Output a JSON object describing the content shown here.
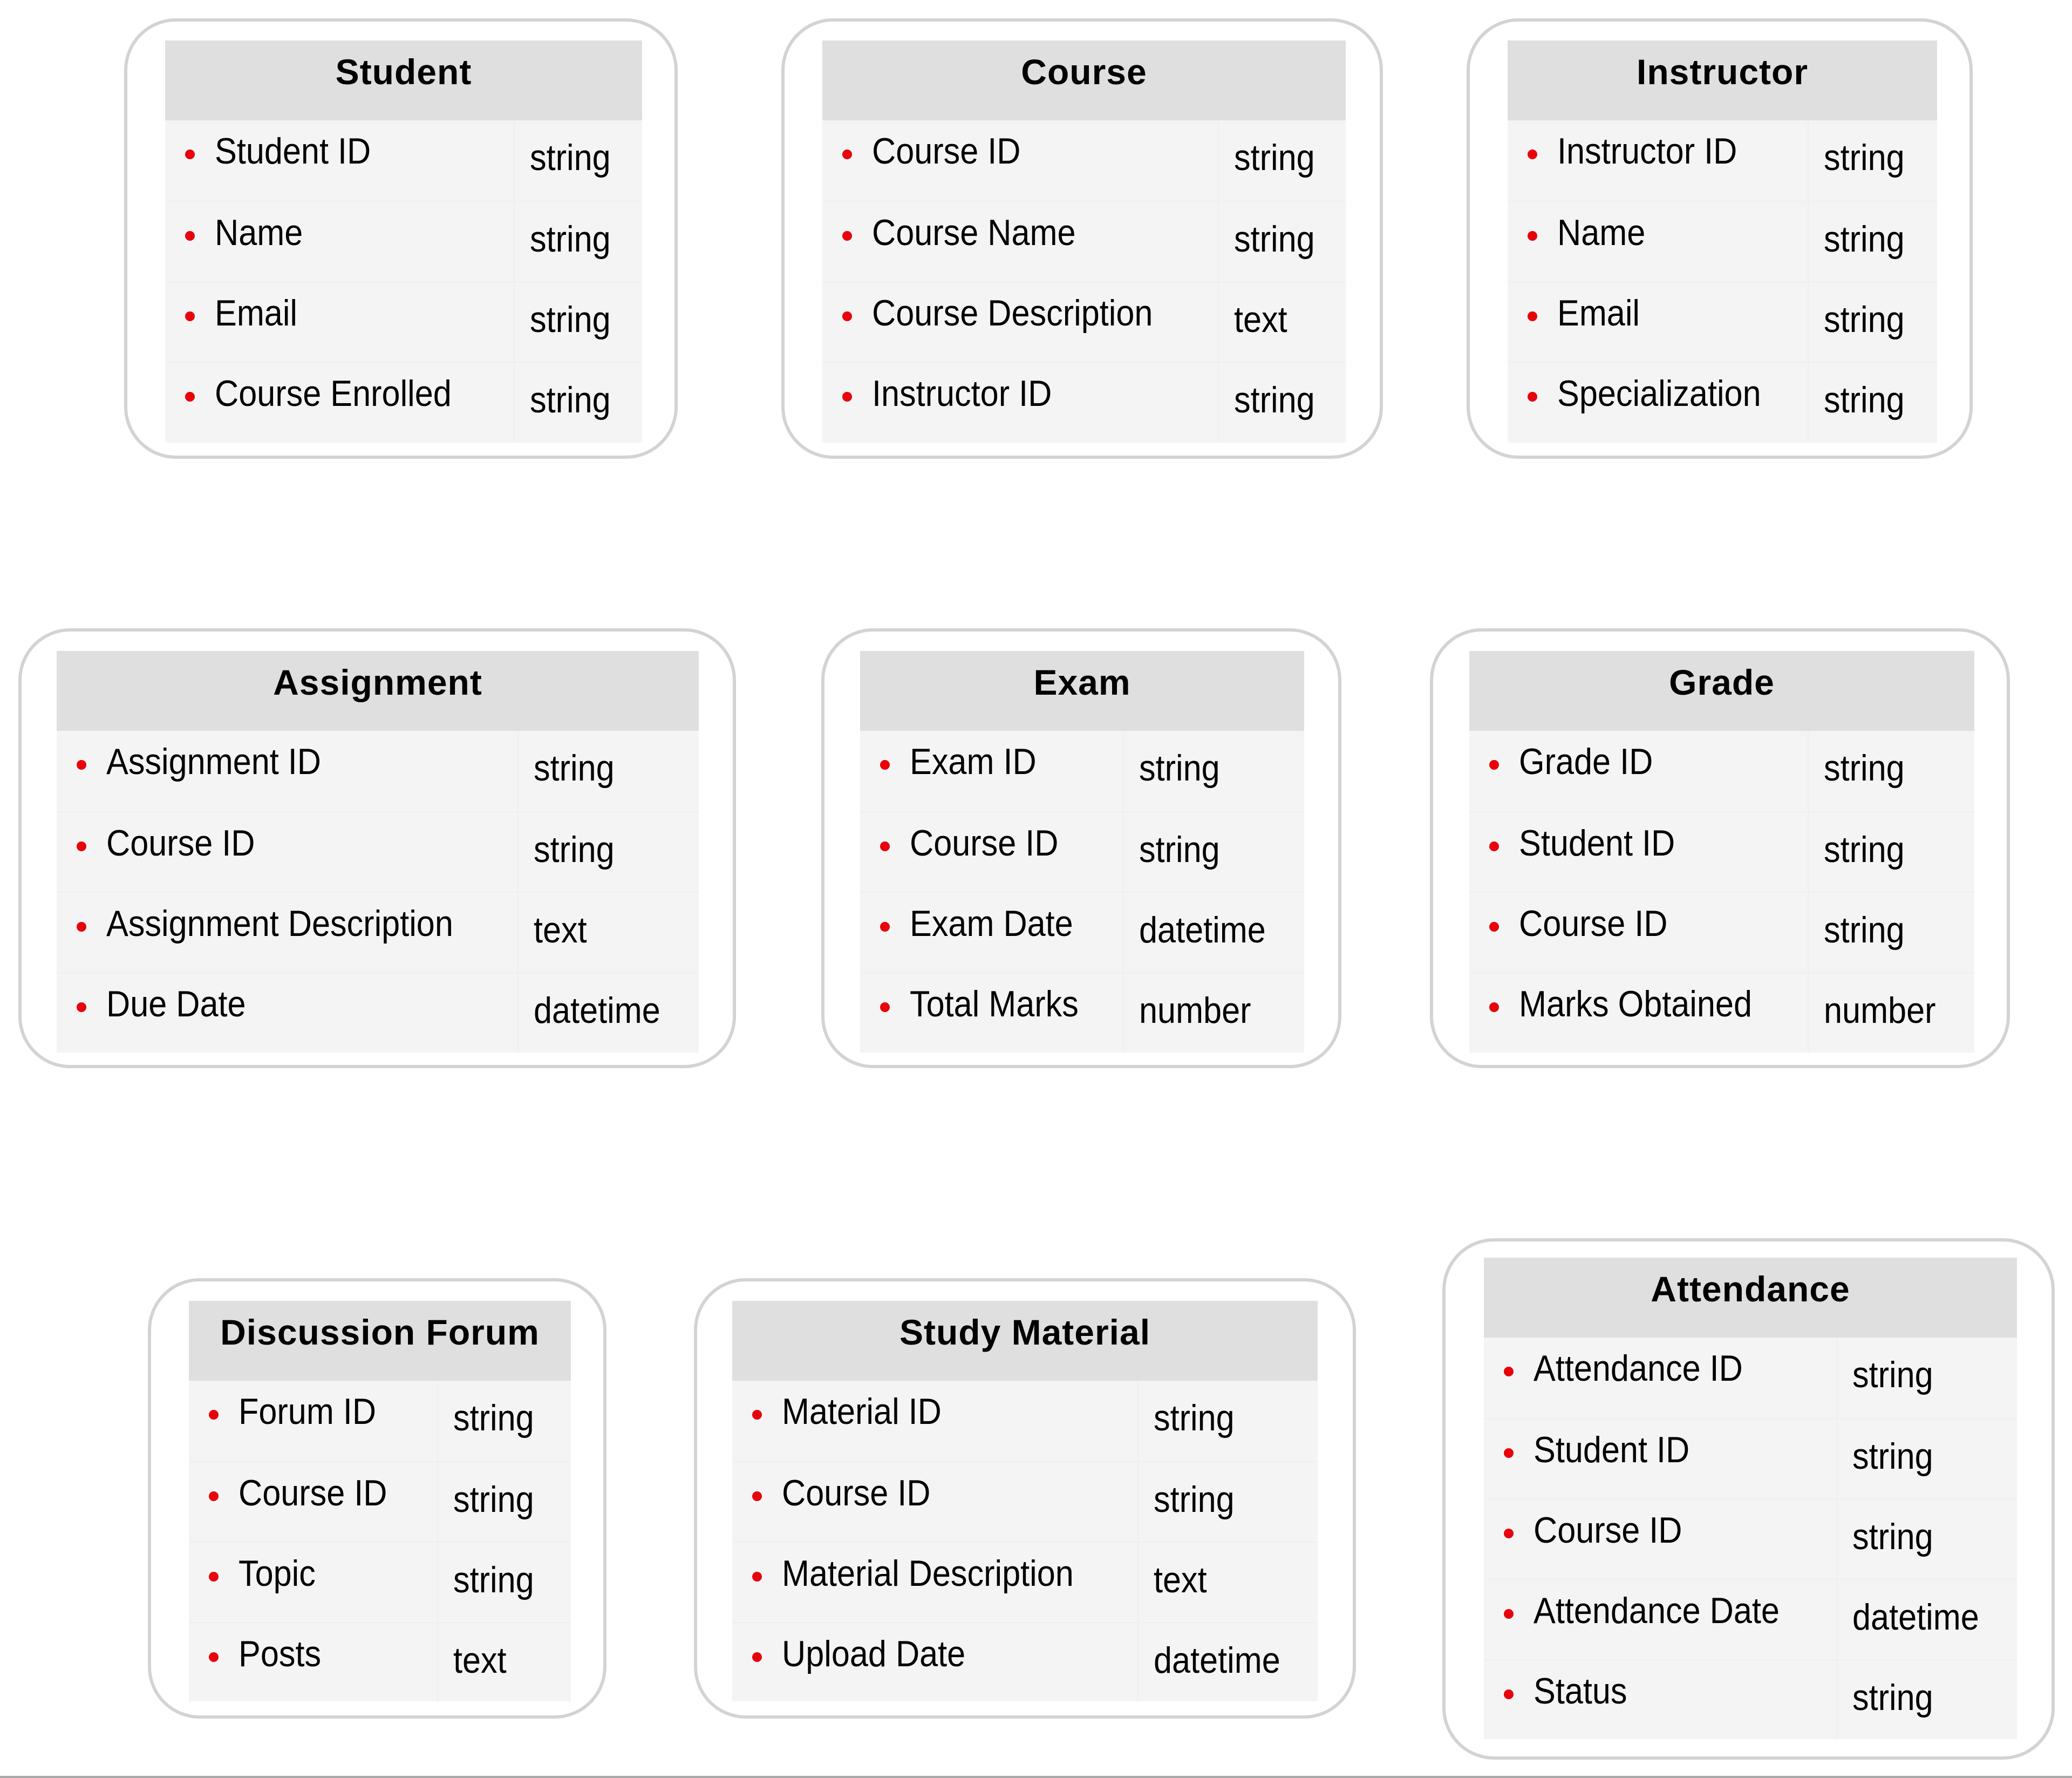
{
  "diagram": {
    "type": "entity-relationship",
    "entities": [
      {
        "id": "student",
        "name": "Student",
        "fields": [
          {
            "name": "Student ID",
            "type": "string"
          },
          {
            "name": "Name",
            "type": "string"
          },
          {
            "name": "Email",
            "type": "string"
          },
          {
            "name": "Course Enrolled",
            "type": "string"
          }
        ]
      },
      {
        "id": "course",
        "name": "Course",
        "fields": [
          {
            "name": "Course ID",
            "type": "string"
          },
          {
            "name": "Course Name",
            "type": "string"
          },
          {
            "name": "Course Description",
            "type": "text"
          },
          {
            "name": "Instructor ID",
            "type": "string"
          }
        ]
      },
      {
        "id": "instructor",
        "name": "Instructor",
        "fields": [
          {
            "name": "Instructor ID",
            "type": "string"
          },
          {
            "name": "Name",
            "type": "string"
          },
          {
            "name": "Email",
            "type": "string"
          },
          {
            "name": "Specialization",
            "type": "string"
          }
        ]
      },
      {
        "id": "assignment",
        "name": "Assignment",
        "fields": [
          {
            "name": "Assignment ID",
            "type": "string"
          },
          {
            "name": "Course ID",
            "type": "string"
          },
          {
            "name": "Assignment Description",
            "type": "text"
          },
          {
            "name": "Due Date",
            "type": "datetime"
          }
        ]
      },
      {
        "id": "exam",
        "name": "Exam",
        "fields": [
          {
            "name": "Exam ID",
            "type": "string"
          },
          {
            "name": "Course ID",
            "type": "string"
          },
          {
            "name": "Exam Date",
            "type": "datetime"
          },
          {
            "name": "Total Marks",
            "type": "number"
          }
        ]
      },
      {
        "id": "grade",
        "name": "Grade",
        "fields": [
          {
            "name": "Grade ID",
            "type": "string"
          },
          {
            "name": "Student ID",
            "type": "string"
          },
          {
            "name": "Course ID",
            "type": "string"
          },
          {
            "name": "Marks Obtained",
            "type": "number"
          }
        ]
      },
      {
        "id": "discussion-forum",
        "name": "Discussion Forum",
        "fields": [
          {
            "name": "Forum ID",
            "type": "string"
          },
          {
            "name": "Course ID",
            "type": "string"
          },
          {
            "name": "Topic",
            "type": "string"
          },
          {
            "name": "Posts",
            "type": "text"
          }
        ]
      },
      {
        "id": "study-material",
        "name": "Study Material",
        "fields": [
          {
            "name": "Material ID",
            "type": "string"
          },
          {
            "name": "Course ID",
            "type": "string"
          },
          {
            "name": "Material Description",
            "type": "text"
          },
          {
            "name": "Upload Date",
            "type": "datetime"
          }
        ]
      },
      {
        "id": "attendance",
        "name": "Attendance",
        "fields": [
          {
            "name": "Attendance ID",
            "type": "string"
          },
          {
            "name": "Student ID",
            "type": "string"
          },
          {
            "name": "Course ID",
            "type": "string"
          },
          {
            "name": "Attendance Date",
            "type": "datetime"
          },
          {
            "name": "Status",
            "type": "string"
          }
        ]
      }
    ]
  },
  "colors": {
    "bullet": "#e8000b",
    "header_bg": "#dfdfdf",
    "body_bg": "#f4f4f4",
    "border": "#d3d3d3"
  }
}
